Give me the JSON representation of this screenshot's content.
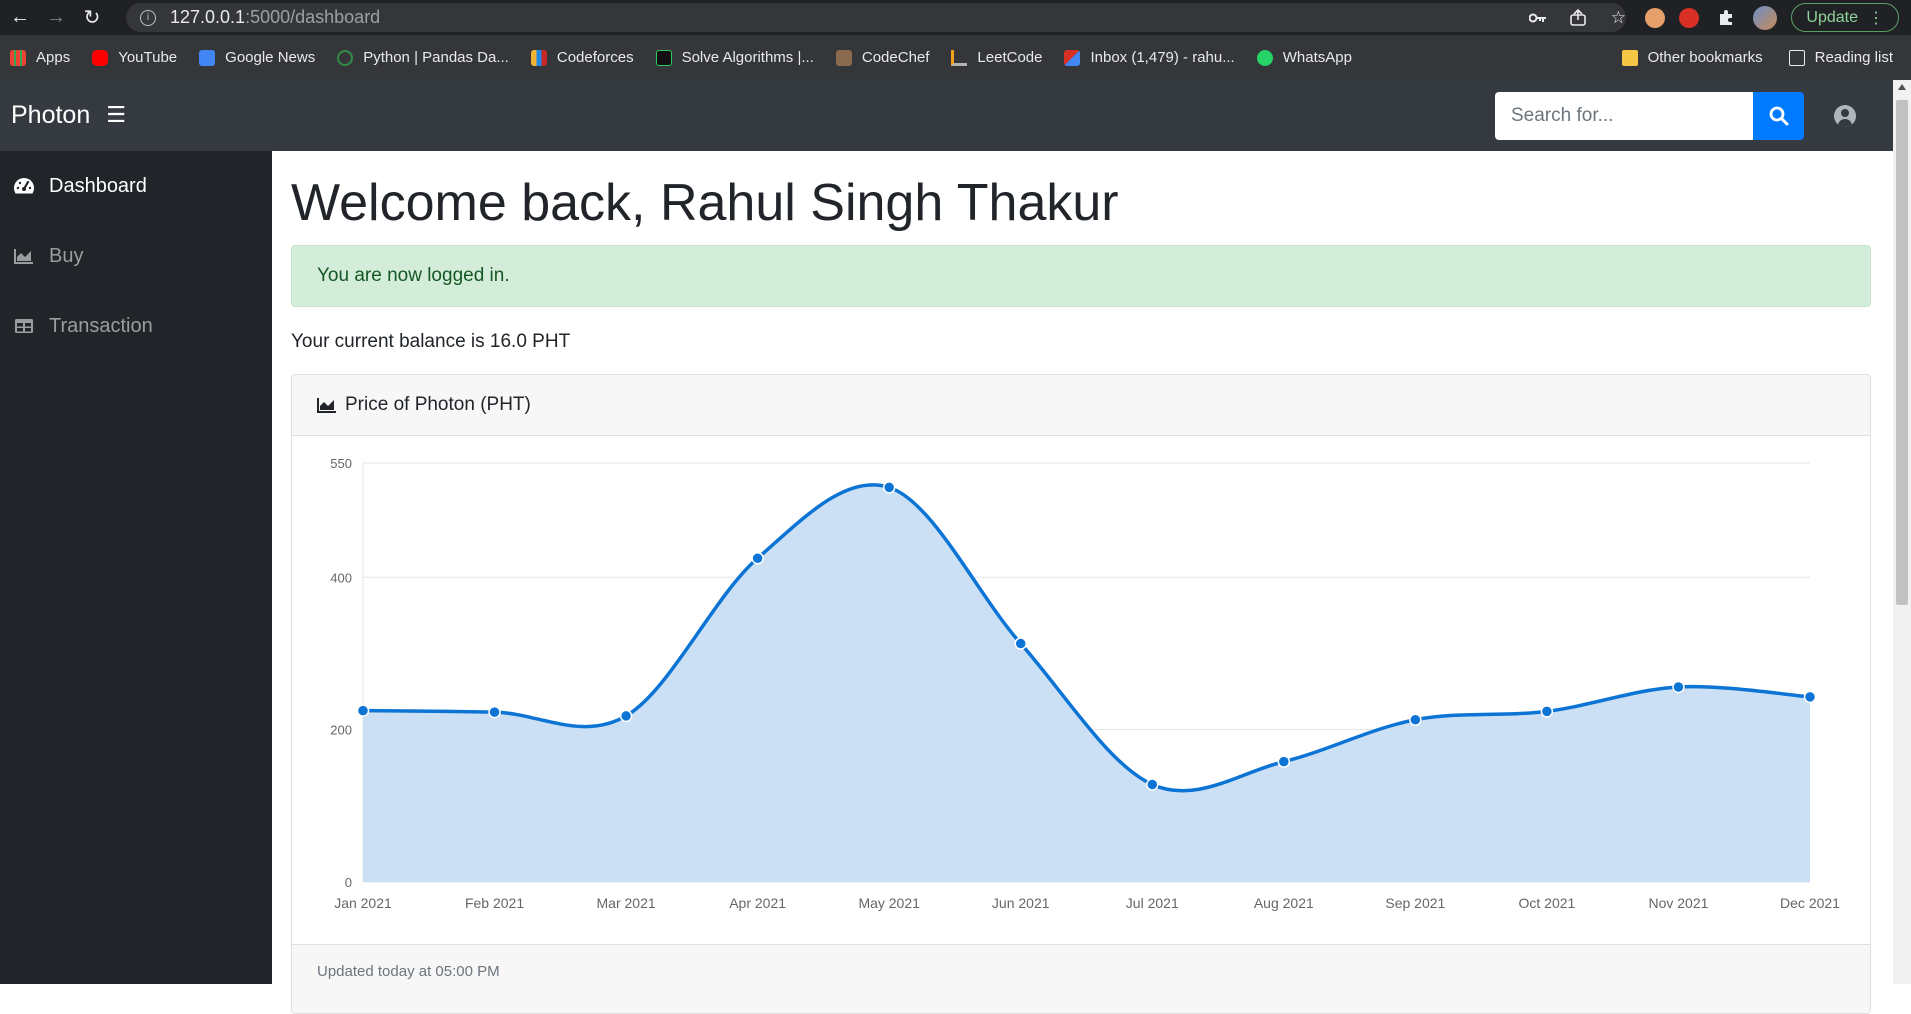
{
  "browser": {
    "url_host": "127.0.0.1",
    "url_path": ":5000/dashboard",
    "update_label": "Update",
    "bookmarks": [
      {
        "label": "Apps",
        "color": "#ea4335"
      },
      {
        "label": "YouTube",
        "color": "#ff0000"
      },
      {
        "label": "Google News",
        "color": "#4285f4"
      },
      {
        "label": "Python | Pandas Da...",
        "color": "#2f8d46"
      },
      {
        "label": "Codeforces",
        "color": "#f2b233"
      },
      {
        "label": "Solve Algorithms |...",
        "color": "#111111"
      },
      {
        "label": "CodeChef",
        "color": "#8b6b4e"
      },
      {
        "label": "LeetCode",
        "color": "#f89f1b"
      },
      {
        "label": "Inbox (1,479) - rahu...",
        "color": "#d93025"
      },
      {
        "label": "WhatsApp",
        "color": "#25d366"
      }
    ],
    "other_bookmarks": "Other bookmarks",
    "reading_list": "Reading list"
  },
  "app": {
    "brand": "Photon",
    "search_placeholder": "Search for...",
    "accent": "#007bff"
  },
  "sidebar": {
    "items": [
      {
        "label": "Dashboard",
        "icon": "tachometer-icon",
        "active": true
      },
      {
        "label": "Buy",
        "icon": "area-chart-icon",
        "active": false
      },
      {
        "label": "Transaction",
        "icon": "table-icon",
        "active": false
      }
    ]
  },
  "main": {
    "welcome": "Welcome back, Rahul Singh Thakur",
    "alert": "You are now logged in.",
    "balance": "Your current balance is 16.0 PHT",
    "card_title": "Price of Photon (PHT)",
    "footer": "Updated today at 05:00 PM"
  },
  "chart_data": {
    "type": "area",
    "title": "Price of Photon (PHT)",
    "categories": [
      "Jan 2021",
      "Feb 2021",
      "Mar 2021",
      "Apr 2021",
      "May 2021",
      "Jun 2021",
      "Jul 2021",
      "Aug 2021",
      "Sep 2021",
      "Oct 2021",
      "Nov 2021",
      "Dec 2021"
    ],
    "values": [
      225,
      223,
      218,
      425,
      518,
      313,
      128,
      158,
      213,
      224,
      256,
      243
    ],
    "yticks": [
      0,
      200,
      400,
      550
    ],
    "ylim": [
      0,
      550
    ],
    "grid": true,
    "line_color": "#0c74d5",
    "fill_color": "#cce0f5"
  }
}
